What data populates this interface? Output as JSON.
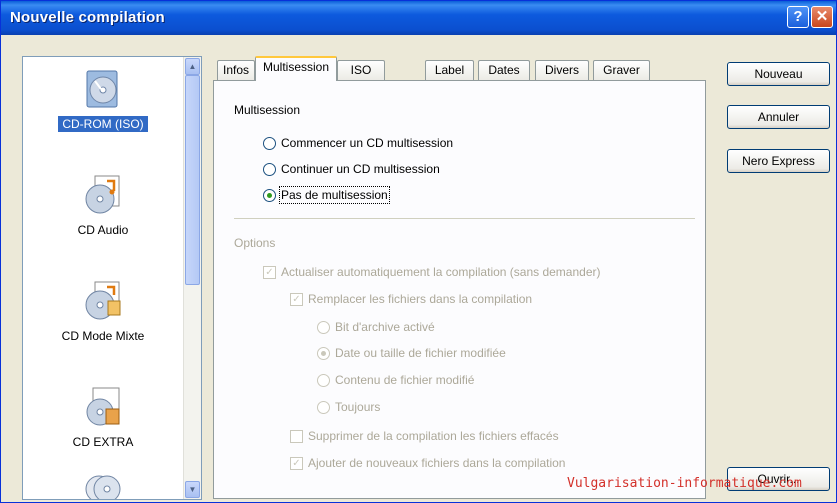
{
  "window": {
    "title": "Nouvelle compilation",
    "help_label": "?",
    "close_label": "✕"
  },
  "list": {
    "items": [
      {
        "label": "CD-ROM (ISO)",
        "icon": "cd-rom-iso-icon",
        "selected": true
      },
      {
        "label": "CD Audio",
        "icon": "cd-audio-icon"
      },
      {
        "label": "CD Mode Mixte",
        "icon": "cd-mixed-mode-icon"
      },
      {
        "label": "CD EXTRA",
        "icon": "cd-extra-icon"
      },
      {
        "label": "",
        "icon": "cd-copy-icon"
      }
    ]
  },
  "tabs": [
    {
      "label": "Infos"
    },
    {
      "label": "Multisession",
      "active": true
    },
    {
      "label": "ISO"
    },
    {
      "label": "Label"
    },
    {
      "label": "Dates"
    },
    {
      "label": "Divers"
    },
    {
      "label": "Graver"
    }
  ],
  "multisession": {
    "heading": "Multisession",
    "options": [
      {
        "label": "Commencer un CD multisession",
        "checked": false
      },
      {
        "label": "Continuer un CD multisession",
        "checked": false
      },
      {
        "label": "Pas de multisession",
        "checked": true
      }
    ]
  },
  "options": {
    "heading": "Options",
    "auto_update": {
      "label": "Actualiser automatiquement la compilation (sans demander)",
      "checked": true
    },
    "replace_files": {
      "label": "Remplacer les fichiers dans la compilation",
      "checked": true
    },
    "replace_modes": [
      {
        "label": "Bit d'archive activé",
        "checked": false
      },
      {
        "label": "Date ou taille de fichier modifiée",
        "checked": true
      },
      {
        "label": "Contenu de fichier modifié",
        "checked": false
      },
      {
        "label": "Toujours",
        "checked": false
      }
    ],
    "delete_files": {
      "label": "Supprimer de la compilation les fichiers effacés",
      "checked": false
    },
    "add_files": {
      "label": "Ajouter de nouveaux fichiers dans la compilation",
      "checked": true
    }
  },
  "buttons": {
    "new": "Nouveau",
    "cancel": "Annuler",
    "nero_express": "Nero Express",
    "open": "Ouvrir..."
  },
  "watermark": "Vulgarisation-informatique.com",
  "colors": {
    "title_bar": "#0b4fcf",
    "selection": "#316ac5",
    "disabled_text": "#aca899",
    "watermark": "#d3302a"
  }
}
